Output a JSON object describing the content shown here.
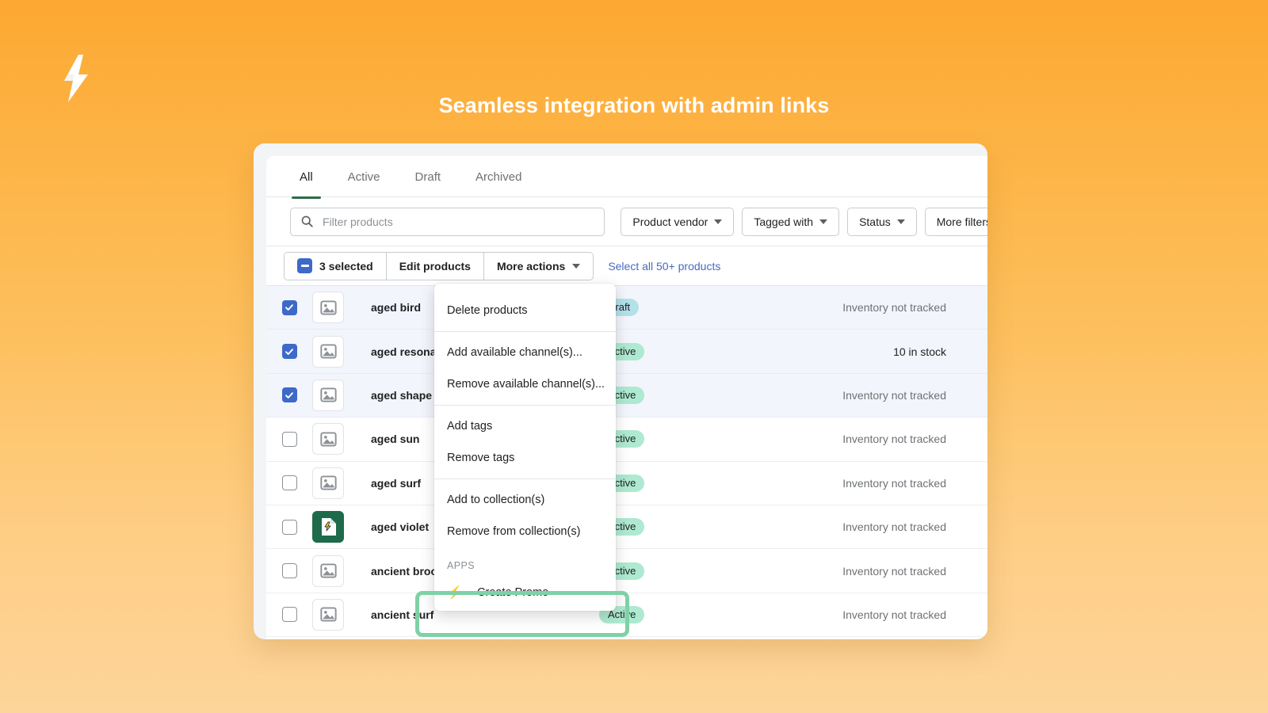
{
  "hero": {
    "title": "Seamless integration with admin links",
    "logo_icon": "lightning-bolt-icon"
  },
  "tabs": [
    {
      "label": "All",
      "active": true
    },
    {
      "label": "Active",
      "active": false
    },
    {
      "label": "Draft",
      "active": false
    },
    {
      "label": "Archived",
      "active": false
    }
  ],
  "filters": {
    "search_placeholder": "Filter products",
    "search_value": "",
    "search_icon": "search-icon",
    "buttons": [
      {
        "label": "Product vendor",
        "caret": true
      },
      {
        "label": "Tagged with",
        "caret": true
      },
      {
        "label": "Status",
        "caret": true
      },
      {
        "label": "More filters",
        "caret": false
      }
    ]
  },
  "bulk": {
    "checkbox_state": "indeterminate",
    "selected_label": "3 selected",
    "edit_label": "Edit products",
    "more_actions_label": "More actions",
    "select_all_label": "Select all 50+ products"
  },
  "more_actions_menu": {
    "groups": [
      {
        "items": [
          {
            "label": "Delete products"
          }
        ]
      },
      {
        "items": [
          {
            "label": "Add available channel(s)..."
          },
          {
            "label": "Remove available channel(s)..."
          }
        ]
      },
      {
        "items": [
          {
            "label": "Add tags"
          },
          {
            "label": "Remove tags"
          }
        ]
      },
      {
        "items": [
          {
            "label": "Add to collection(s)"
          },
          {
            "label": "Remove from collection(s)"
          }
        ]
      }
    ],
    "apps_section_label": "APPS",
    "app_item": {
      "label": "Create Promo",
      "icon": "lightning-bolt-icon"
    },
    "highlight_color": "#7fd1a6"
  },
  "table": {
    "rows": [
      {
        "name": "aged bird",
        "selected": true,
        "status": "Draft",
        "status_kind": "draft",
        "inventory": "Inventory not tracked",
        "inventory_strong": false,
        "thumb": "image-placeholder-icon"
      },
      {
        "name": "aged resonance",
        "selected": true,
        "status": "Active",
        "status_kind": "active",
        "inventory": "10 in stock",
        "inventory_strong": true,
        "thumb": "image-placeholder-icon"
      },
      {
        "name": "aged shape",
        "selected": true,
        "status": "Active",
        "status_kind": "active",
        "inventory": "Inventory not tracked",
        "inventory_strong": false,
        "thumb": "image-placeholder-icon"
      },
      {
        "name": "aged sun",
        "selected": false,
        "status": "Active",
        "status_kind": "active",
        "inventory": "Inventory not tracked",
        "inventory_strong": false,
        "thumb": "image-placeholder-icon"
      },
      {
        "name": "aged surf",
        "selected": false,
        "status": "Active",
        "status_kind": "active",
        "inventory": "Inventory not tracked",
        "inventory_strong": false,
        "thumb": "image-placeholder-icon"
      },
      {
        "name": "aged violet",
        "selected": false,
        "status": "Active",
        "status_kind": "active",
        "inventory": "Inventory not tracked",
        "inventory_strong": false,
        "thumb": "app-promo-icon"
      },
      {
        "name": "ancient brook",
        "selected": false,
        "status": "Active",
        "status_kind": "active",
        "inventory": "Inventory not tracked",
        "inventory_strong": false,
        "thumb": "image-placeholder-icon"
      },
      {
        "name": "ancient surf",
        "selected": false,
        "status": "Active",
        "status_kind": "active",
        "inventory": "Inventory not tracked",
        "inventory_strong": false,
        "thumb": "image-placeholder-icon"
      }
    ]
  },
  "colors": {
    "background_top": "#fca832",
    "background_bottom": "#fdd49a",
    "tab_accent": "#2c6e49",
    "checkbox_blue": "#3d69c9",
    "link_blue": "#4a68c4",
    "badge_draft": "#b3e1ea",
    "badge_active": "#aee9d1",
    "app_icon_yellow": "#f7b733",
    "highlight_green": "#7fd1a6"
  }
}
